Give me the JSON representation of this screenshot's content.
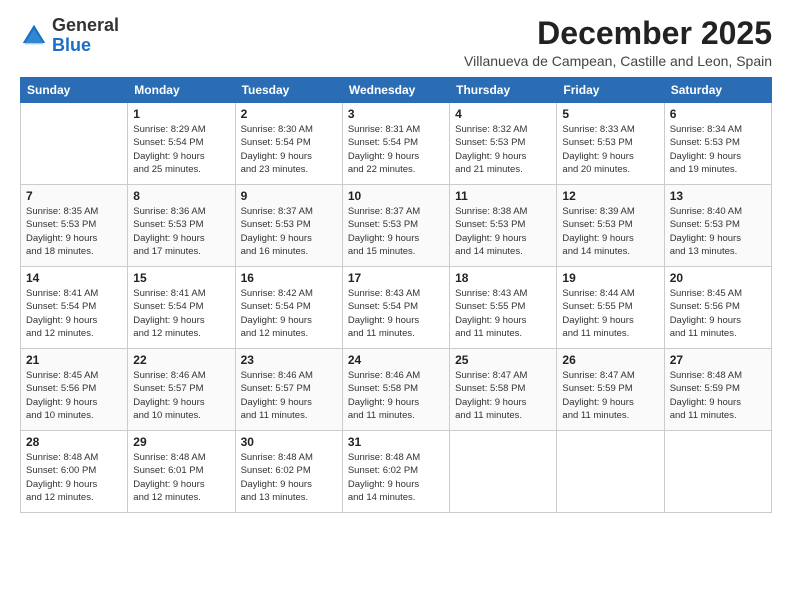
{
  "logo": {
    "general": "General",
    "blue": "Blue"
  },
  "title": "December 2025",
  "location": "Villanueva de Campean, Castille and Leon, Spain",
  "weekdays": [
    "Sunday",
    "Monday",
    "Tuesday",
    "Wednesday",
    "Thursday",
    "Friday",
    "Saturday"
  ],
  "weeks": [
    [
      {
        "day": "",
        "info": ""
      },
      {
        "day": "1",
        "info": "Sunrise: 8:29 AM\nSunset: 5:54 PM\nDaylight: 9 hours\nand 25 minutes."
      },
      {
        "day": "2",
        "info": "Sunrise: 8:30 AM\nSunset: 5:54 PM\nDaylight: 9 hours\nand 23 minutes."
      },
      {
        "day": "3",
        "info": "Sunrise: 8:31 AM\nSunset: 5:54 PM\nDaylight: 9 hours\nand 22 minutes."
      },
      {
        "day": "4",
        "info": "Sunrise: 8:32 AM\nSunset: 5:53 PM\nDaylight: 9 hours\nand 21 minutes."
      },
      {
        "day": "5",
        "info": "Sunrise: 8:33 AM\nSunset: 5:53 PM\nDaylight: 9 hours\nand 20 minutes."
      },
      {
        "day": "6",
        "info": "Sunrise: 8:34 AM\nSunset: 5:53 PM\nDaylight: 9 hours\nand 19 minutes."
      }
    ],
    [
      {
        "day": "7",
        "info": "Sunrise: 8:35 AM\nSunset: 5:53 PM\nDaylight: 9 hours\nand 18 minutes."
      },
      {
        "day": "8",
        "info": "Sunrise: 8:36 AM\nSunset: 5:53 PM\nDaylight: 9 hours\nand 17 minutes."
      },
      {
        "day": "9",
        "info": "Sunrise: 8:37 AM\nSunset: 5:53 PM\nDaylight: 9 hours\nand 16 minutes."
      },
      {
        "day": "10",
        "info": "Sunrise: 8:37 AM\nSunset: 5:53 PM\nDaylight: 9 hours\nand 15 minutes."
      },
      {
        "day": "11",
        "info": "Sunrise: 8:38 AM\nSunset: 5:53 PM\nDaylight: 9 hours\nand 14 minutes."
      },
      {
        "day": "12",
        "info": "Sunrise: 8:39 AM\nSunset: 5:53 PM\nDaylight: 9 hours\nand 14 minutes."
      },
      {
        "day": "13",
        "info": "Sunrise: 8:40 AM\nSunset: 5:53 PM\nDaylight: 9 hours\nand 13 minutes."
      }
    ],
    [
      {
        "day": "14",
        "info": "Sunrise: 8:41 AM\nSunset: 5:54 PM\nDaylight: 9 hours\nand 12 minutes."
      },
      {
        "day": "15",
        "info": "Sunrise: 8:41 AM\nSunset: 5:54 PM\nDaylight: 9 hours\nand 12 minutes."
      },
      {
        "day": "16",
        "info": "Sunrise: 8:42 AM\nSunset: 5:54 PM\nDaylight: 9 hours\nand 12 minutes."
      },
      {
        "day": "17",
        "info": "Sunrise: 8:43 AM\nSunset: 5:54 PM\nDaylight: 9 hours\nand 11 minutes."
      },
      {
        "day": "18",
        "info": "Sunrise: 8:43 AM\nSunset: 5:55 PM\nDaylight: 9 hours\nand 11 minutes."
      },
      {
        "day": "19",
        "info": "Sunrise: 8:44 AM\nSunset: 5:55 PM\nDaylight: 9 hours\nand 11 minutes."
      },
      {
        "day": "20",
        "info": "Sunrise: 8:45 AM\nSunset: 5:56 PM\nDaylight: 9 hours\nand 11 minutes."
      }
    ],
    [
      {
        "day": "21",
        "info": "Sunrise: 8:45 AM\nSunset: 5:56 PM\nDaylight: 9 hours\nand 10 minutes."
      },
      {
        "day": "22",
        "info": "Sunrise: 8:46 AM\nSunset: 5:57 PM\nDaylight: 9 hours\nand 10 minutes."
      },
      {
        "day": "23",
        "info": "Sunrise: 8:46 AM\nSunset: 5:57 PM\nDaylight: 9 hours\nand 11 minutes."
      },
      {
        "day": "24",
        "info": "Sunrise: 8:46 AM\nSunset: 5:58 PM\nDaylight: 9 hours\nand 11 minutes."
      },
      {
        "day": "25",
        "info": "Sunrise: 8:47 AM\nSunset: 5:58 PM\nDaylight: 9 hours\nand 11 minutes."
      },
      {
        "day": "26",
        "info": "Sunrise: 8:47 AM\nSunset: 5:59 PM\nDaylight: 9 hours\nand 11 minutes."
      },
      {
        "day": "27",
        "info": "Sunrise: 8:48 AM\nSunset: 5:59 PM\nDaylight: 9 hours\nand 11 minutes."
      }
    ],
    [
      {
        "day": "28",
        "info": "Sunrise: 8:48 AM\nSunset: 6:00 PM\nDaylight: 9 hours\nand 12 minutes."
      },
      {
        "day": "29",
        "info": "Sunrise: 8:48 AM\nSunset: 6:01 PM\nDaylight: 9 hours\nand 12 minutes."
      },
      {
        "day": "30",
        "info": "Sunrise: 8:48 AM\nSunset: 6:02 PM\nDaylight: 9 hours\nand 13 minutes."
      },
      {
        "day": "31",
        "info": "Sunrise: 8:48 AM\nSunset: 6:02 PM\nDaylight: 9 hours\nand 14 minutes."
      },
      {
        "day": "",
        "info": ""
      },
      {
        "day": "",
        "info": ""
      },
      {
        "day": "",
        "info": ""
      }
    ]
  ]
}
